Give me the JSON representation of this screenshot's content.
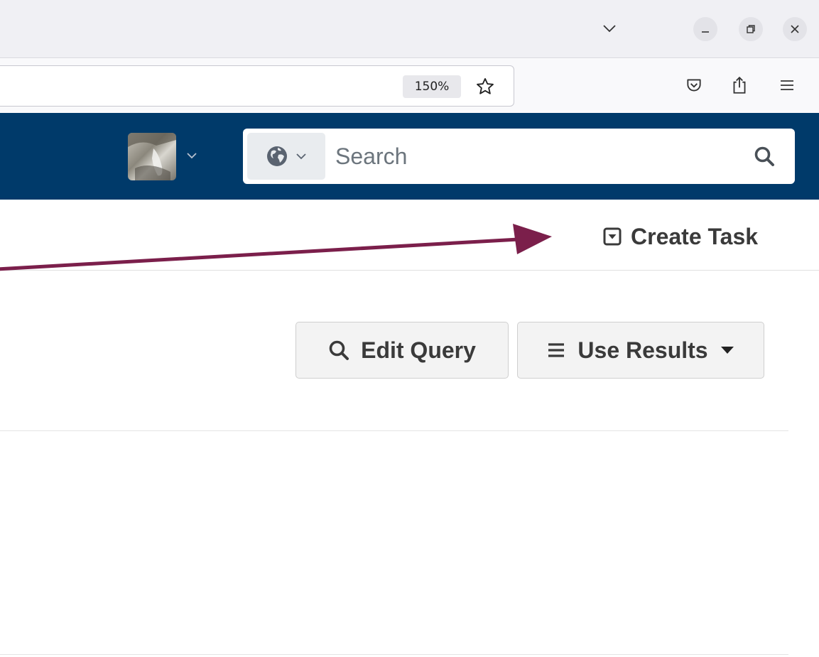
{
  "browser": {
    "zoom_level": "150%",
    "icons": {
      "tab_list": "chevron-down-icon",
      "minimize": "minimize-icon",
      "maximize": "restore-icon",
      "close": "close-icon",
      "bookmark_star": "star-icon",
      "pocket": "pocket-icon",
      "share": "share-icon",
      "menu": "hamburger-icon"
    }
  },
  "header": {
    "background_color": "#003a6a",
    "search": {
      "placeholder": "Search",
      "scope_icon": "globe-icon"
    },
    "bookmarks_icon": "bookmark-icon",
    "avatar_icon": "user-avatar"
  },
  "toolbar": {
    "create_task_label": "Create Task"
  },
  "actions": {
    "edit_query_label": "Edit Query",
    "use_results_label": "Use Results"
  },
  "annotation": {
    "arrow_color": "#7b1f4b"
  }
}
